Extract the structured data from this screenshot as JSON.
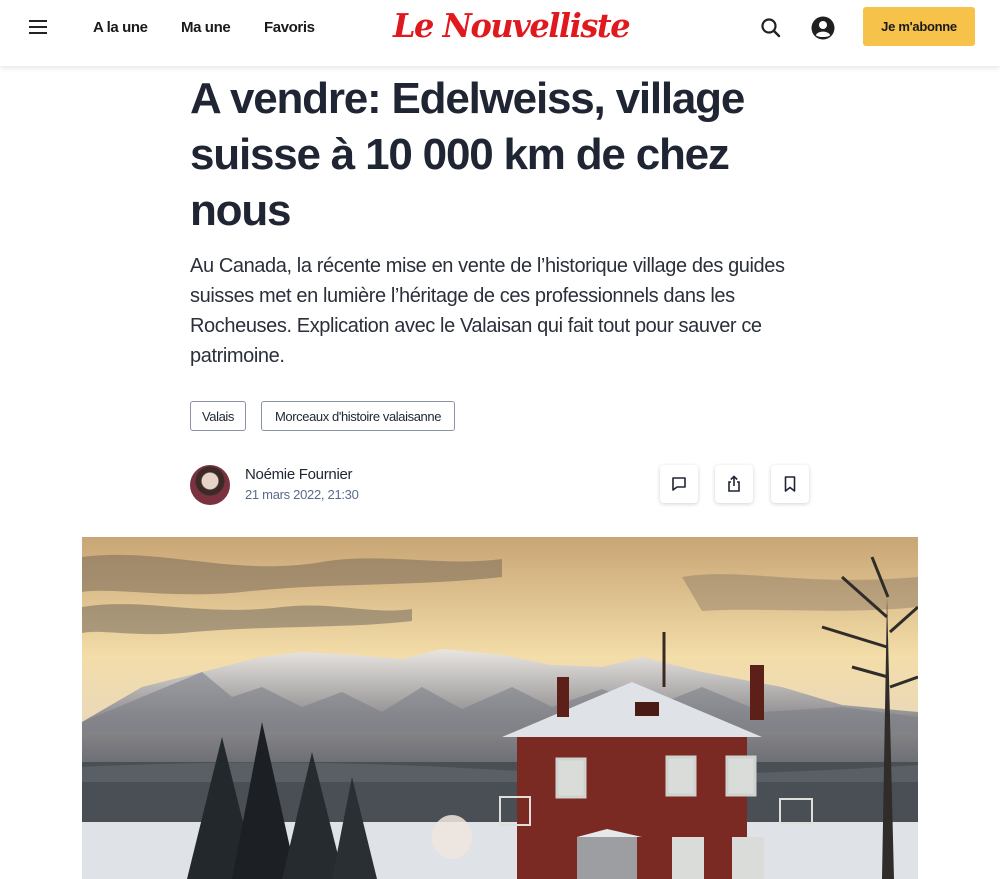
{
  "header": {
    "nav": [
      "A la une",
      "Ma une",
      "Favoris"
    ],
    "logo": "Le Nouvelliste",
    "subscribe_label": "Je m'abonne",
    "icons": [
      "menu-icon",
      "search-icon",
      "account-icon"
    ]
  },
  "article": {
    "title": "A vendre: Edelweiss, village suisse à 10 000 km de chez nous",
    "lead": "Au Canada, la récente mise en vente de l’historique village des guides suisses met en lumière l’héritage de ces professionnels dans les Rocheuses. Explication avec le Valaisan qui fait tout pour sauver ce patrimoine.",
    "tags": [
      "Valais",
      "Morceaux d'histoire valaisanne"
    ],
    "author": "Noémie Fournier",
    "date": "21 mars 2022, 21:30",
    "actions": [
      "comment-icon",
      "share-icon",
      "bookmark-icon"
    ]
  },
  "colors": {
    "brand_red": "#e0191e",
    "subscribe_yellow": "#f6c24a",
    "date_blue": "#5a6b8a"
  }
}
